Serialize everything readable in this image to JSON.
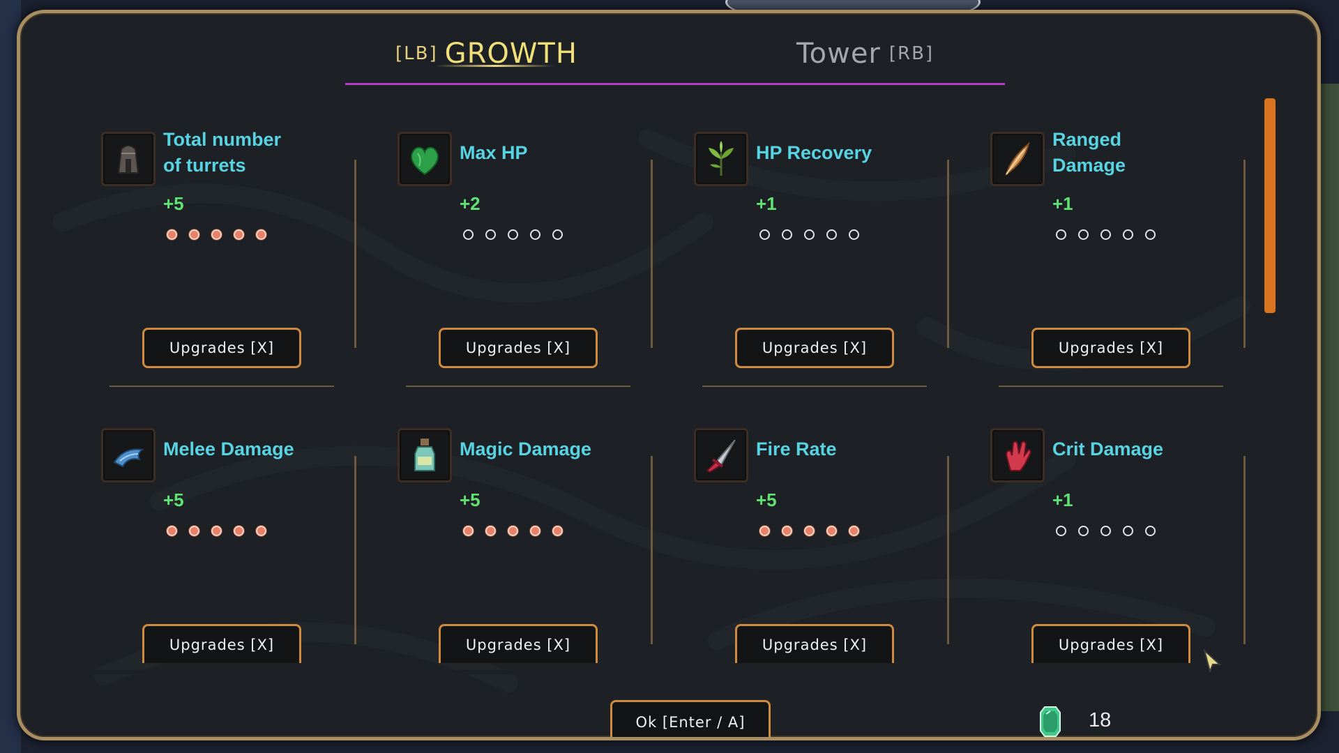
{
  "tabs": {
    "active": {
      "hint_left": "[LB]",
      "label": "GROWTH"
    },
    "inactive": {
      "label": "Tower",
      "hint_right": "[RB]"
    }
  },
  "colors": {
    "title": "#58d3e2",
    "bonus": "#60e272",
    "accent_orange": "#d08a3f",
    "tab_active": "#f1e07a",
    "tab_underline": "#b23fc4",
    "scrollbar": "#d9731f"
  },
  "upgrades": [
    {
      "title": "Total number of turrets",
      "bonus": "+5",
      "level": 5,
      "max_level": 5,
      "button": "Upgrades [X]",
      "icon": "turret-icon"
    },
    {
      "title": "Max HP",
      "bonus": "+2",
      "level": 0,
      "max_level": 5,
      "button": "Upgrades [X]",
      "icon": "green-heart-icon"
    },
    {
      "title": "HP Recovery",
      "bonus": "+1",
      "level": 0,
      "max_level": 5,
      "button": "Upgrades [X]",
      "icon": "herb-sprout-icon"
    },
    {
      "title": "Ranged Damage",
      "bonus": "+1",
      "level": 0,
      "max_level": 5,
      "button": "Upgrades [X]",
      "icon": "feather-quill-icon"
    },
    {
      "title": "Melee Damage",
      "bonus": "+5",
      "level": 5,
      "max_level": 5,
      "button": "Upgrades [X]",
      "icon": "blue-claw-icon"
    },
    {
      "title": "Magic Damage",
      "bonus": "+5",
      "level": 5,
      "max_level": 5,
      "button": "Upgrades [X]",
      "icon": "potion-bottle-icon"
    },
    {
      "title": "Fire Rate",
      "bonus": "+5",
      "level": 5,
      "max_level": 5,
      "button": "Upgrades [X]",
      "icon": "red-dagger-icon"
    },
    {
      "title": "Crit Damage",
      "bonus": "+1",
      "level": 0,
      "max_level": 5,
      "button": "Upgrades [X]",
      "icon": "red-glove-icon"
    }
  ],
  "footer": {
    "ok_label": "Ok [Enter / A]",
    "currency_icon": "green-gem-icon",
    "currency_value": "18"
  }
}
